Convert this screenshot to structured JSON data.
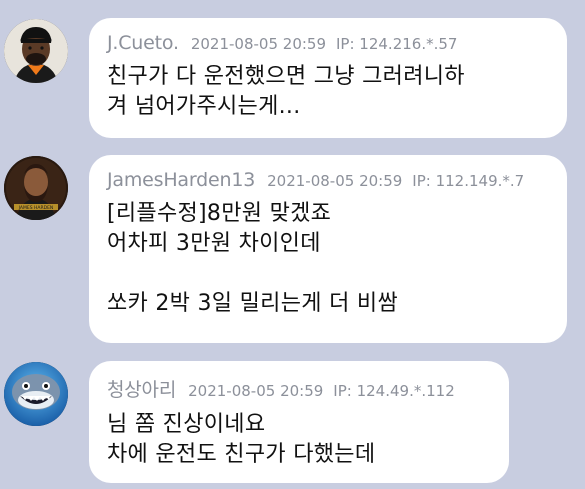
{
  "comments": [
    {
      "author": "J.Cueto.",
      "date": "2021-08-05 20:59",
      "ip": "IP: 124.216.*.57",
      "text": "친구가 다 운전했으면 그냥 그러려니하\n겨 넘어가주시는게...",
      "avatar_icon": "baseball-player-avatar-icon"
    },
    {
      "author": "JamesHarden13",
      "date": "2021-08-05 20:59",
      "ip": "IP: 112.149.*.7",
      "text": "[리플수정]8만원 맞겠죠\n어차피 3만원 차이인데\n\n쏘카 2박 3일 밀리는게 더 비쌈",
      "avatar_icon": "james-harden-avatar-icon"
    },
    {
      "author": "청상아리",
      "date": "2021-08-05 20:59",
      "ip": "IP: 124.49.*.112",
      "text": "님 쫌 진상이네요\n차에 운전도 친구가 다했는데",
      "avatar_icon": "shark-avatar-icon"
    }
  ],
  "colors": {
    "background": "#c8cde0",
    "bubble": "#ffffff",
    "meta_text": "#8c909a",
    "body_text": "#111111"
  }
}
